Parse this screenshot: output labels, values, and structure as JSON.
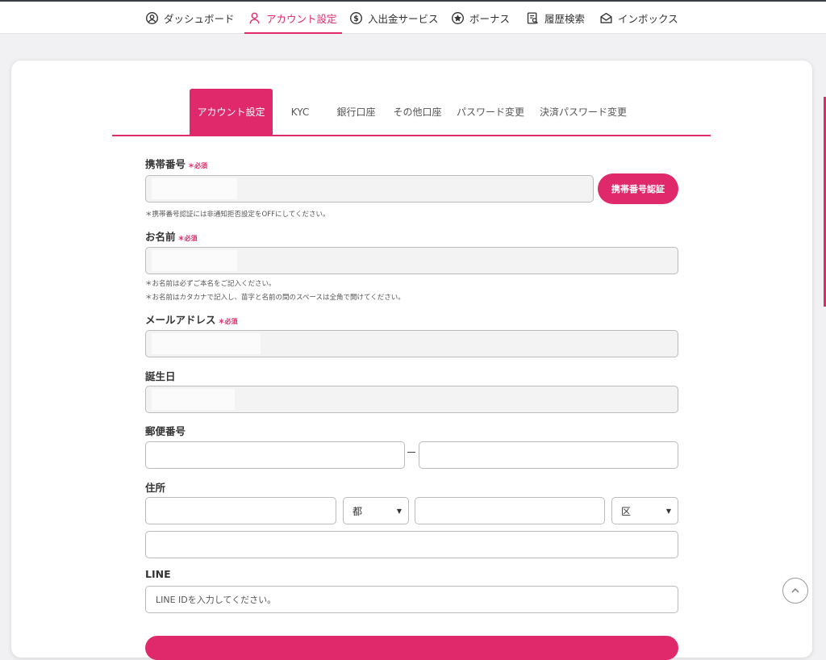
{
  "nav": {
    "items": [
      {
        "label": "ダッシュボード",
        "icon": "user-circle-icon"
      },
      {
        "label": "アカウント設定",
        "icon": "person-icon"
      },
      {
        "label": "入出金サービス",
        "icon": "dollar-coin-icon"
      },
      {
        "label": "ボーナス",
        "icon": "star-circle-icon"
      },
      {
        "label": "履歴検索",
        "icon": "document-search-icon"
      },
      {
        "label": "インボックス",
        "icon": "envelope-icon"
      }
    ],
    "active_index": 1
  },
  "tabs": [
    "アカウント設定",
    "KYC",
    "銀行口座",
    "その他口座",
    "パスワード変更",
    "決済パスワード変更"
  ],
  "form": {
    "required_mark": "＊必須",
    "phone": {
      "label": "携帯番号",
      "verify_button": "携帯番号認証",
      "note": "＊携帯番号認証には非通知拒否設定をOFFにしてください。"
    },
    "name": {
      "label": "お名前",
      "notes": [
        "＊お名前は必ずご本名をご記入ください。",
        "＊お名前はカタカナで記入し、苗字と名前の間のスペースは全角で開けてください。"
      ]
    },
    "email": {
      "label": "メールアドレス"
    },
    "birthday": {
      "label": "誕生日"
    },
    "postal": {
      "label": "郵便番号",
      "separator": "–"
    },
    "address": {
      "label": "住所",
      "prefecture_select": "都",
      "ward_select": "区"
    },
    "line": {
      "label": "LINE",
      "placeholder": "LINE IDを入力してください。"
    }
  },
  "colors": {
    "accent": "#e0296b",
    "field_bg": "#f3f3f3",
    "border": "#bbbbbb"
  }
}
